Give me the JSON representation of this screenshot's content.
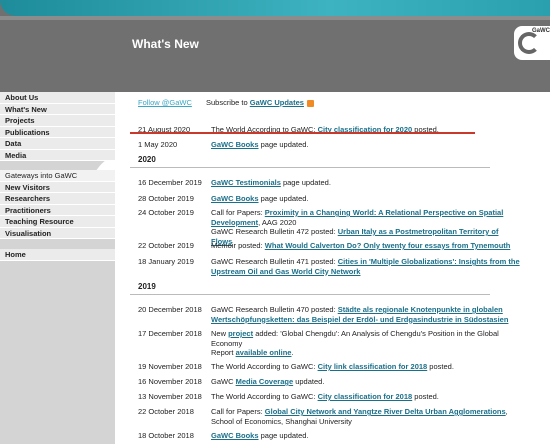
{
  "header": {
    "title": "What's New",
    "logo_text": "GaWC"
  },
  "sidebar": {
    "group1": [
      "About Us",
      "What's New",
      "Projects",
      "Publications",
      "Data",
      "Media"
    ],
    "group2_heading": "Gateways into GaWC",
    "group2": [
      "New Visitors",
      "Researchers",
      "Practitioners",
      "Teaching Resource",
      "Visualisation"
    ],
    "home": "Home"
  },
  "topline": {
    "follow": "Follow @GaWC",
    "subscribe_prefix": "Subscribe to",
    "subscribe_link": "GaWC Updates"
  },
  "entries": {
    "e1": {
      "date": "21 August 2020",
      "pre": "The World According to GaWC: ",
      "link": "City classification for 2020",
      "post": " posted."
    },
    "e2": {
      "date": "1 May 2020",
      "link": "GaWC Books",
      "post": " page updated."
    },
    "y2020": "2020",
    "e3": {
      "date": "16 December 2019",
      "link": "GaWC Testimonials",
      "post": " page updated."
    },
    "e4": {
      "date": "28 October 2019",
      "link": "GaWC Books",
      "post": " page updated."
    },
    "e5": {
      "date": "24 October 2019",
      "pre": "Call for Papers: ",
      "link": "Proximity in a Changing World: A Relational Perspective on Spatial Development",
      "post": ", AAG 2020",
      "pre2": "GaWC Research Bulletin 472 posted: ",
      "link2": "Urban Italy as a Postmetropolitan Territory of Flows"
    },
    "e6": {
      "date": "22 October 2019",
      "pre": "Memoir posted: ",
      "link": "What Would Calverton Do? Only twenty four essays from Tynemouth"
    },
    "e7": {
      "date": "18 January 2019",
      "pre": "GaWC Research Bulletin 471 posted: ",
      "link": "Cities in 'Multiple Globalizations': Insights from the Upstream Oil and Gas World City Network"
    },
    "y2019": "2019",
    "e8": {
      "date": "20 December 2018",
      "pre": "GaWC Research Bulletin 470 posted: ",
      "link": "Städte als regionale Knotenpunkte in globalen Wertschöpfungsketten: das Beispiel der Erdöl- und Erdgasindustrie in Südostasien"
    },
    "e9": {
      "date": "17 December 2018",
      "pre": "New ",
      "link": "project",
      "post": " added: 'Global Chengdu': An Analysis of Chengdu's Position in the Global Economy",
      "pre2": "Report ",
      "link2": "available online",
      "post2": "."
    },
    "e10": {
      "date": "19 November 2018",
      "pre": "The World According to GaWC: ",
      "link": "City link classification for 2018",
      "post": " posted."
    },
    "e11": {
      "date": "16 November 2018",
      "pre": "GaWC ",
      "link": "Media Coverage",
      "post": " updated."
    },
    "e12": {
      "date": "13 November 2018",
      "pre": "The World According to GaWC: ",
      "link": "City classification for 2018",
      "post": " posted."
    },
    "e13": {
      "date": "22 October 2018",
      "pre": "Call for Papers: ",
      "link": "Global City Network and Yangtze River Delta Urban Agglomerations",
      "post": ", School of Economics, Shanghai University"
    },
    "e14": {
      "date": "18 October 2018",
      "link": "GaWC Books",
      "post": " page updated."
    }
  },
  "colors": {
    "accent_rule": "#c8392b",
    "link": "#1a6f8a",
    "follow": "#3aa7c4",
    "header_band": "#3db2c0"
  }
}
